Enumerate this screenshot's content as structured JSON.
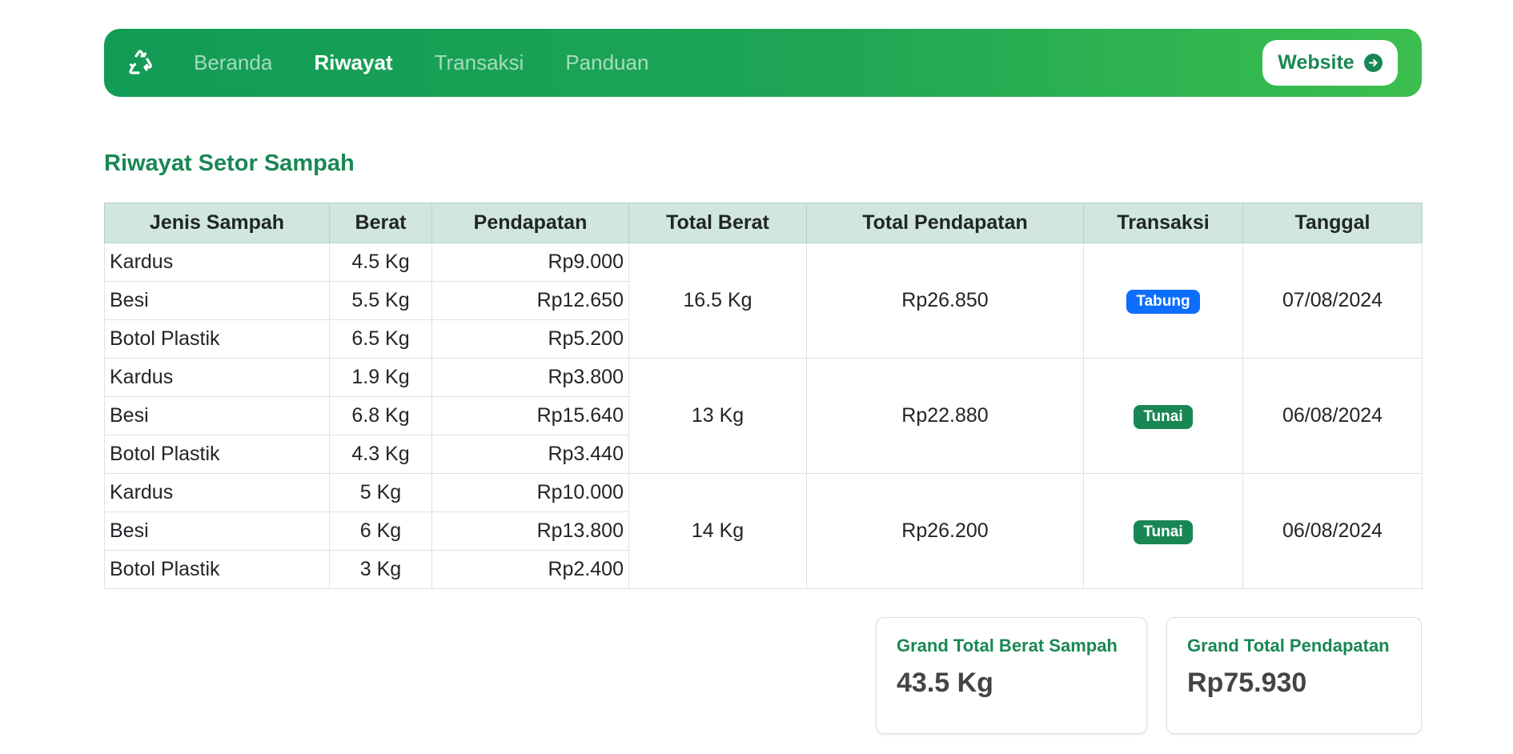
{
  "nav": {
    "links": [
      {
        "label": "Beranda",
        "active": false
      },
      {
        "label": "Riwayat",
        "active": true
      },
      {
        "label": "Transaksi",
        "active": false
      },
      {
        "label": "Panduan",
        "active": false
      }
    ],
    "website_label": "Website",
    "brand_icon": "recycle-icon",
    "gradient_start": "#129b55",
    "gradient_end": "#3cbf4e"
  },
  "page_title": "Riwayat Setor Sampah",
  "table": {
    "headers": [
      "Jenis Sampah",
      "Berat",
      "Pendapatan",
      "Total Berat",
      "Total Pendapatan",
      "Transaksi",
      "Tanggal"
    ],
    "groups": [
      {
        "items": [
          {
            "jenis": "Kardus",
            "berat": "4.5 Kg",
            "pendapatan": "Rp9.000"
          },
          {
            "jenis": "Besi",
            "berat": "5.5 Kg",
            "pendapatan": "Rp12.650"
          },
          {
            "jenis": "Botol Plastik",
            "berat": "6.5 Kg",
            "pendapatan": "Rp5.200"
          }
        ],
        "total_berat": "16.5 Kg",
        "total_pendapatan": "Rp26.850",
        "transaksi": "Tabung",
        "transaksi_color": "#0d6efd",
        "tanggal": "07/08/2024"
      },
      {
        "items": [
          {
            "jenis": "Kardus",
            "berat": "1.9 Kg",
            "pendapatan": "Rp3.800"
          },
          {
            "jenis": "Besi",
            "berat": "6.8 Kg",
            "pendapatan": "Rp15.640"
          },
          {
            "jenis": "Botol Plastik",
            "berat": "4.3 Kg",
            "pendapatan": "Rp3.440"
          }
        ],
        "total_berat": "13 Kg",
        "total_pendapatan": "Rp22.880",
        "transaksi": "Tunai",
        "transaksi_color": "#198754",
        "tanggal": "06/08/2024"
      },
      {
        "items": [
          {
            "jenis": "Kardus",
            "berat": "5 Kg",
            "pendapatan": "Rp10.000"
          },
          {
            "jenis": "Besi",
            "berat": "6 Kg",
            "pendapatan": "Rp13.800"
          },
          {
            "jenis": "Botol Plastik",
            "berat": "3 Kg",
            "pendapatan": "Rp2.400"
          }
        ],
        "total_berat": "14 Kg",
        "total_pendapatan": "Rp26.200",
        "transaksi": "Tunai",
        "transaksi_color": "#198754",
        "tanggal": "06/08/2024"
      }
    ]
  },
  "summary": {
    "berat_title": "Grand Total Berat Sampah",
    "berat_value": "43.5 Kg",
    "pendapatan_title": "Grand Total Pendapatan",
    "pendapatan_value": "Rp75.930"
  }
}
